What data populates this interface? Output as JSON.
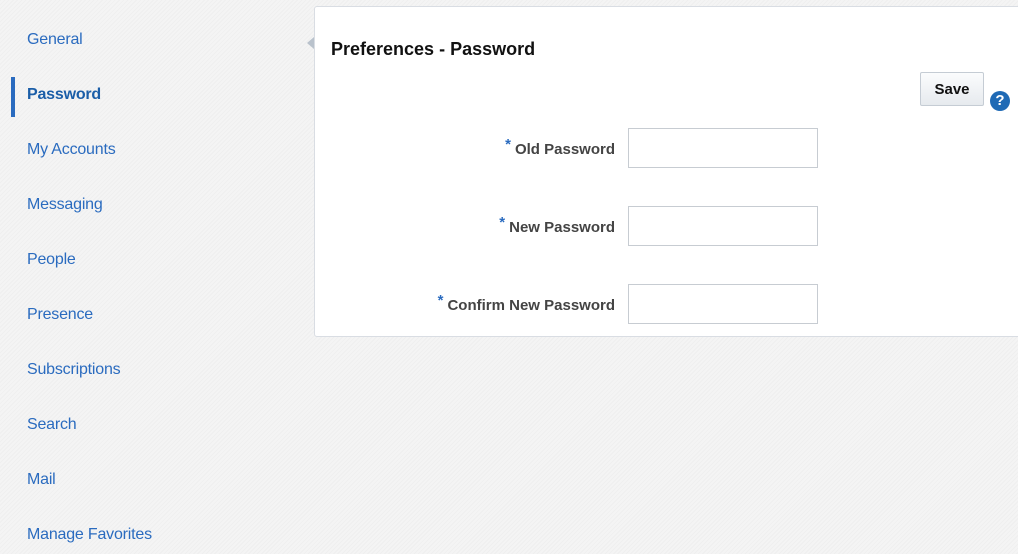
{
  "sidebar": {
    "items": [
      {
        "label": "General",
        "active": false
      },
      {
        "label": "Password",
        "active": true
      },
      {
        "label": "My Accounts",
        "active": false
      },
      {
        "label": "Messaging",
        "active": false
      },
      {
        "label": "People",
        "active": false
      },
      {
        "label": "Presence",
        "active": false
      },
      {
        "label": "Subscriptions",
        "active": false
      },
      {
        "label": "Search",
        "active": false
      },
      {
        "label": "Mail",
        "active": false
      },
      {
        "label": "Manage Favorites",
        "active": false
      }
    ]
  },
  "panel": {
    "title": "Preferences - Password",
    "save_label": "Save",
    "help_icon": "?",
    "required_marker": "*",
    "fields": [
      {
        "label": "Old Password",
        "value": ""
      },
      {
        "label": "New Password",
        "value": ""
      },
      {
        "label": "Confirm New Password",
        "value": ""
      }
    ]
  },
  "colors": {
    "link": "#2a6bbf",
    "active_indicator": "#2a6bbf",
    "help_icon_bg": "#1f6ab5"
  }
}
